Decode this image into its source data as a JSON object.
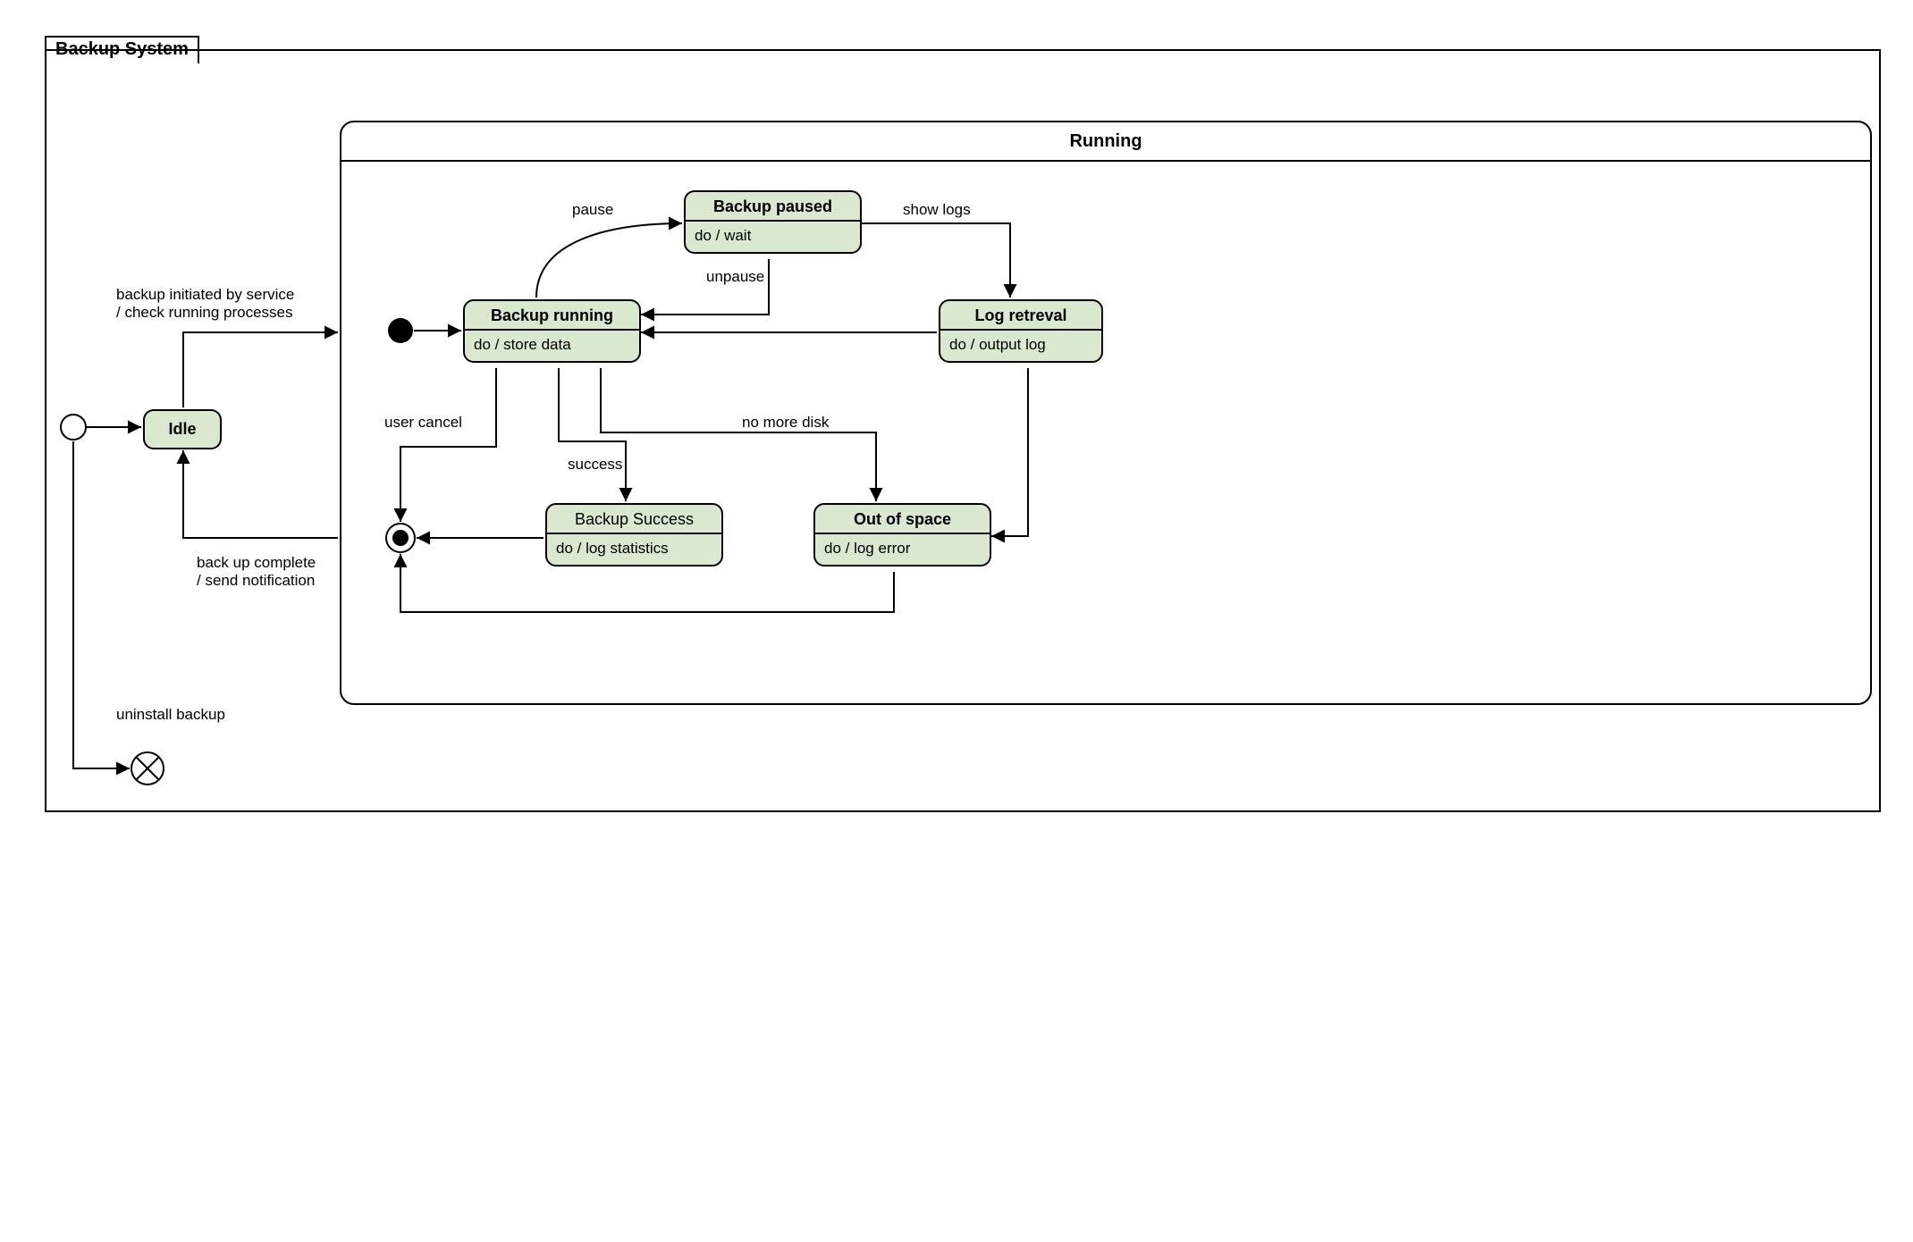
{
  "frame": {
    "title": "Backup System"
  },
  "running": {
    "title": "Running"
  },
  "states": {
    "idle": {
      "name": "Idle"
    },
    "backup_running": {
      "name": "Backup running",
      "body": "do / store data"
    },
    "backup_paused": {
      "name": "Backup paused",
      "body": "do / wait"
    },
    "log_retrieval": {
      "name": "Log retreval",
      "body": "do / output log"
    },
    "backup_success": {
      "name": "Backup Success",
      "body": "do / log statistics"
    },
    "out_of_space": {
      "name": "Out of space",
      "body": "do / log error"
    }
  },
  "transitions": {
    "init_to_running": "backup initiated by service\n/ check running processes",
    "running_to_idle": "back up complete\n/ send notification",
    "uninstall": "uninstall backup",
    "pause": "pause",
    "unpause": "unpause",
    "show_logs": "show logs",
    "user_cancel": "user cancel",
    "no_more_disk": "no more disk",
    "success": "success"
  }
}
